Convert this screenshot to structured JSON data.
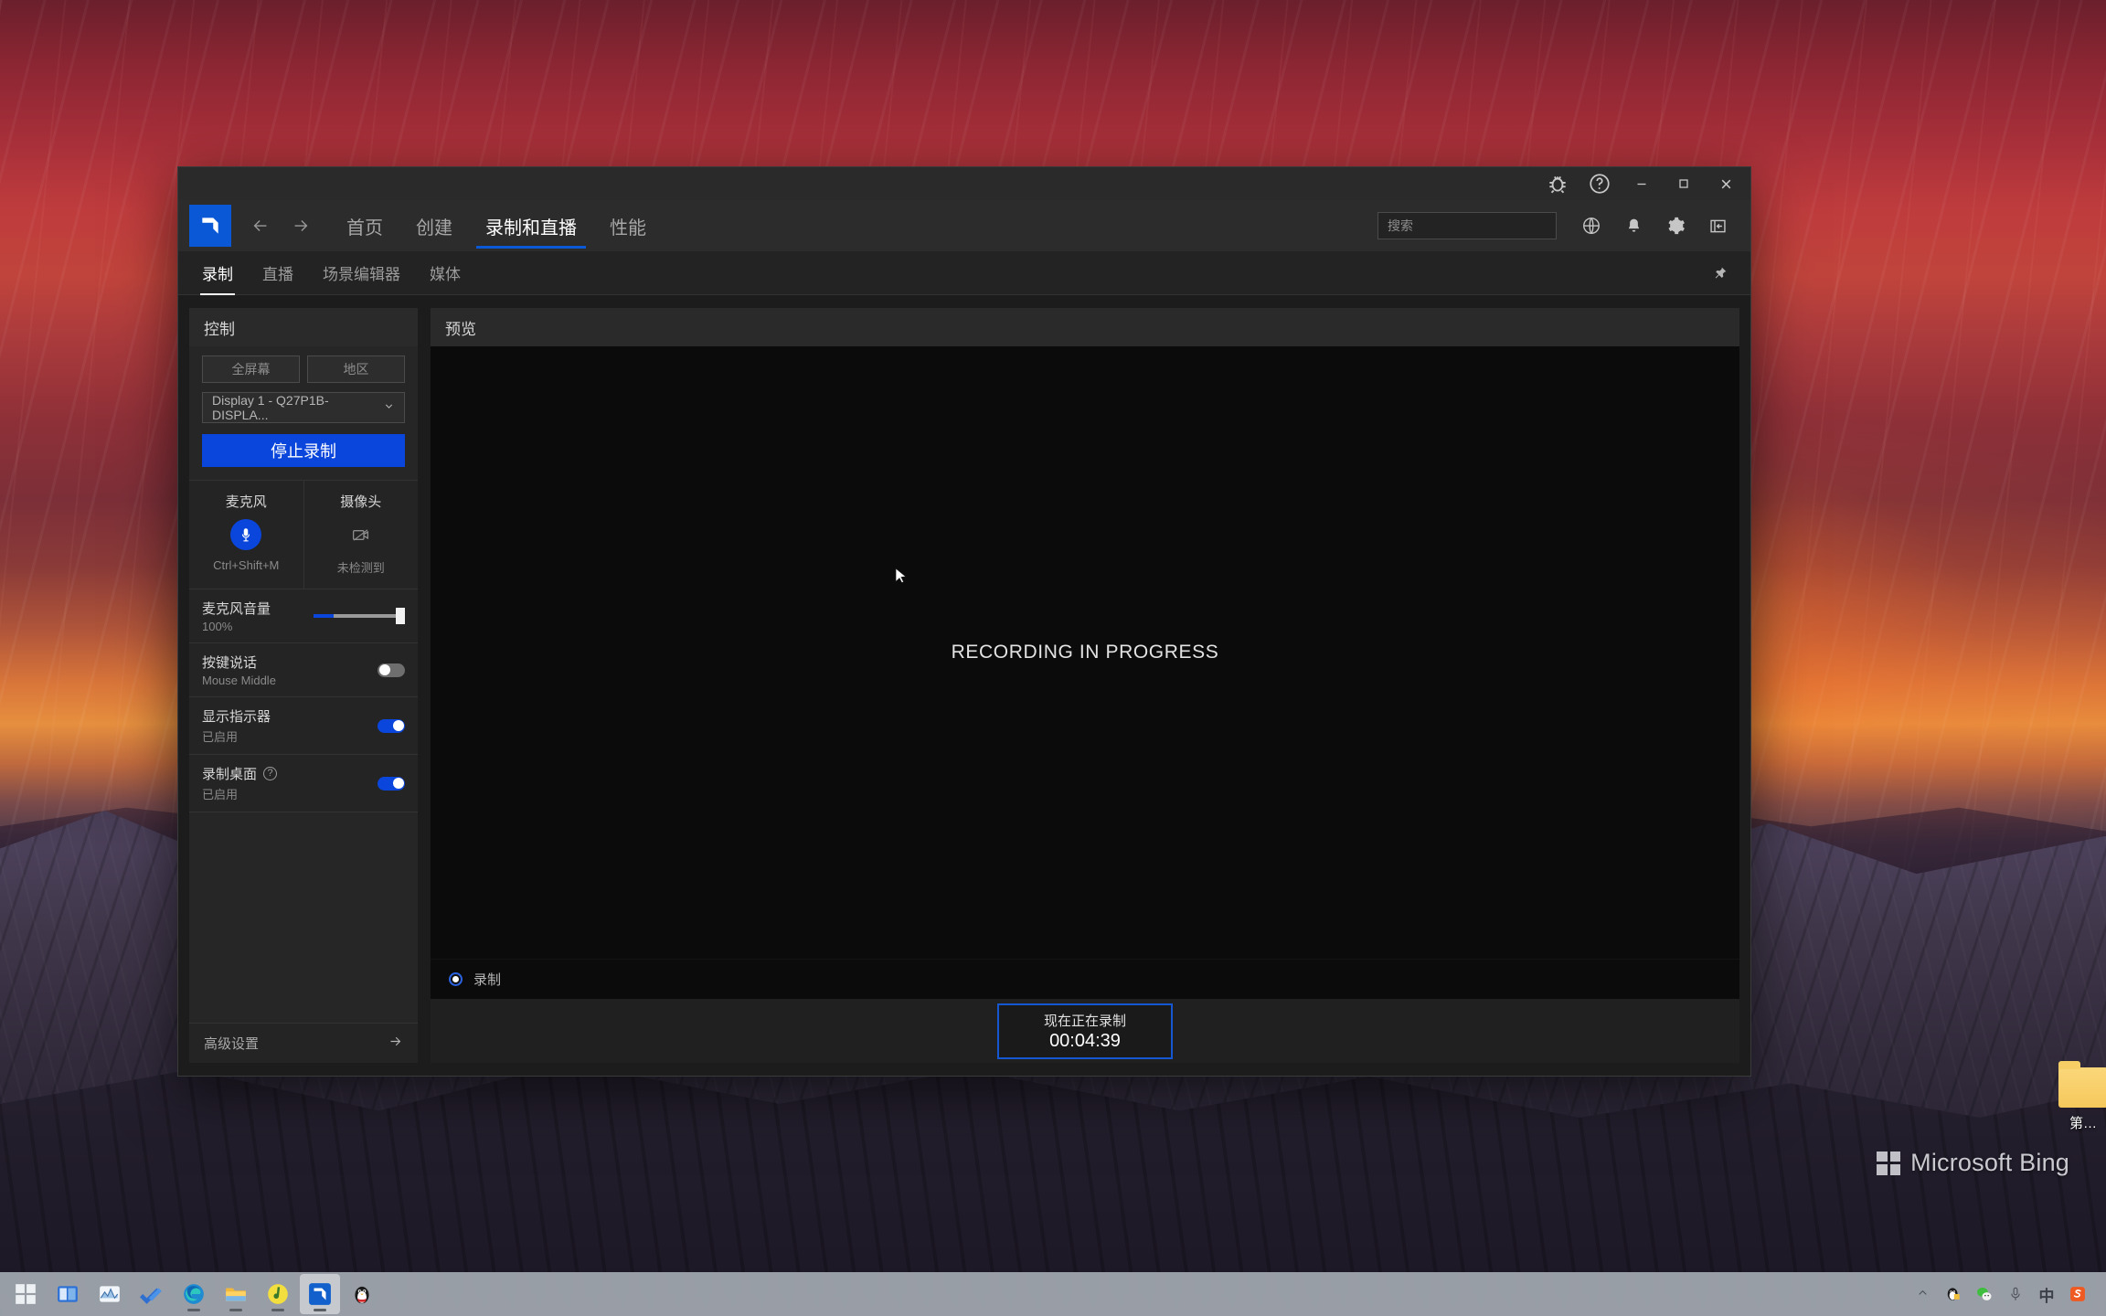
{
  "desktop": {
    "bing_watermark": "Microsoft Bing",
    "folder_label": "第…",
    "taskbar": {
      "left_items": [
        {
          "name": "start-button",
          "icon": "windows-start-icon"
        },
        {
          "name": "task-view-button",
          "icon": "task-view-icon"
        },
        {
          "name": "widgets-button",
          "icon": "widgets-chart-icon"
        },
        {
          "name": "todo-app",
          "icon": "blue-check-icon"
        },
        {
          "name": "microsoft-edge",
          "icon": "edge-icon"
        },
        {
          "name": "file-explorer",
          "icon": "folder-icon"
        },
        {
          "name": "netease-music",
          "icon": "music-note-icon"
        },
        {
          "name": "amd-adrenalin",
          "icon": "amd-arrow-icon"
        },
        {
          "name": "qq",
          "icon": "penguin-icon"
        }
      ],
      "tray_items": [
        {
          "name": "tray-overflow",
          "icon": "chevron-up-icon"
        },
        {
          "name": "tray-qq",
          "icon": "penguin-icon"
        },
        {
          "name": "tray-wechat",
          "icon": "wechat-icon"
        },
        {
          "name": "tray-microphone",
          "icon": "microphone-icon"
        },
        {
          "name": "tray-ime",
          "icon": "ime-chinese-icon",
          "label": "中"
        },
        {
          "name": "tray-sogou",
          "icon": "sogou-icon",
          "label": "S"
        }
      ]
    }
  },
  "window": {
    "titlebar_buttons": [
      {
        "name": "bug-report-button",
        "icon": "bug-icon"
      },
      {
        "name": "help-button",
        "icon": "question-circle-icon"
      },
      {
        "name": "minimize-button",
        "icon": "minimize-icon"
      },
      {
        "name": "maximize-button",
        "icon": "maximize-icon"
      },
      {
        "name": "close-button",
        "icon": "close-icon"
      }
    ],
    "nav": {
      "logo": "amd-logo",
      "back_icon": "arrow-left-icon",
      "forward_icon": "arrow-right-icon",
      "items": [
        {
          "label": "首页",
          "active": false
        },
        {
          "label": "创建",
          "active": false
        },
        {
          "label": "录制和直播",
          "active": true
        },
        {
          "label": "性能",
          "active": false
        }
      ],
      "search": {
        "placeholder": "搜索",
        "value": "",
        "icon": "search-icon"
      },
      "icons": [
        {
          "name": "globe-icon",
          "label": "社区"
        },
        {
          "name": "bell-icon",
          "label": "通知"
        },
        {
          "name": "gear-icon",
          "label": "设置"
        },
        {
          "name": "panel-collapse-icon",
          "label": "折叠"
        }
      ]
    },
    "subtabs": [
      {
        "label": "录制",
        "active": true
      },
      {
        "label": "直播",
        "active": false
      },
      {
        "label": "场景编辑器",
        "active": false
      },
      {
        "label": "媒体",
        "active": false
      }
    ],
    "pin_icon": "pin-icon"
  },
  "control_panel": {
    "header": "控制",
    "capture_modes": [
      {
        "label": "全屏幕",
        "selected": false
      },
      {
        "label": "地区",
        "selected": false
      }
    ],
    "display_select": {
      "value": "Display 1 - Q27P1B- DISPLA...",
      "caret_icon": "chevron-down-icon"
    },
    "primary_button": "停止录制",
    "devices": [
      {
        "name": "microphone",
        "title": "麦克风",
        "icon": "microphone-icon",
        "enabled": true,
        "sub": "Ctrl+Shift+M"
      },
      {
        "name": "camera",
        "title": "摄像头",
        "icon": "camera-off-icon",
        "enabled": false,
        "sub": "未检测到"
      }
    ],
    "settings": [
      {
        "name": "mic-volume",
        "label": "麦克风音量",
        "value": "100%",
        "control": "slider",
        "slider_percent": 100,
        "has_help": false
      },
      {
        "name": "push-to-talk",
        "label": "按键说话",
        "value": "Mouse Middle",
        "control": "toggle",
        "toggle_on": false,
        "has_help": false
      },
      {
        "name": "show-indicator",
        "label": "显示指示器",
        "value": "已启用",
        "control": "toggle",
        "toggle_on": true,
        "has_help": false
      },
      {
        "name": "record-desktop",
        "label": "录制桌面",
        "value": "已启用",
        "control": "toggle",
        "toggle_on": true,
        "has_help": true,
        "help_icon": "question-circle-icon"
      }
    ],
    "advanced": {
      "label": "高级设置",
      "arrow_icon": "arrow-right-icon"
    }
  },
  "preview": {
    "header": "预览",
    "stage_text": "RECORDING IN PROGRESS",
    "cursor_icon": "mouse-cursor-icon",
    "mode": {
      "label": "录制",
      "selected": true
    },
    "status": {
      "title": "现在正在录制",
      "time": "00:04:39"
    }
  },
  "colors": {
    "accent_blue": "#0a46dc",
    "nav_active_underline": "#0a58d6",
    "timer_border": "#1457d0",
    "panel_bg": "#262626",
    "window_bg": "#1c1c1c"
  }
}
